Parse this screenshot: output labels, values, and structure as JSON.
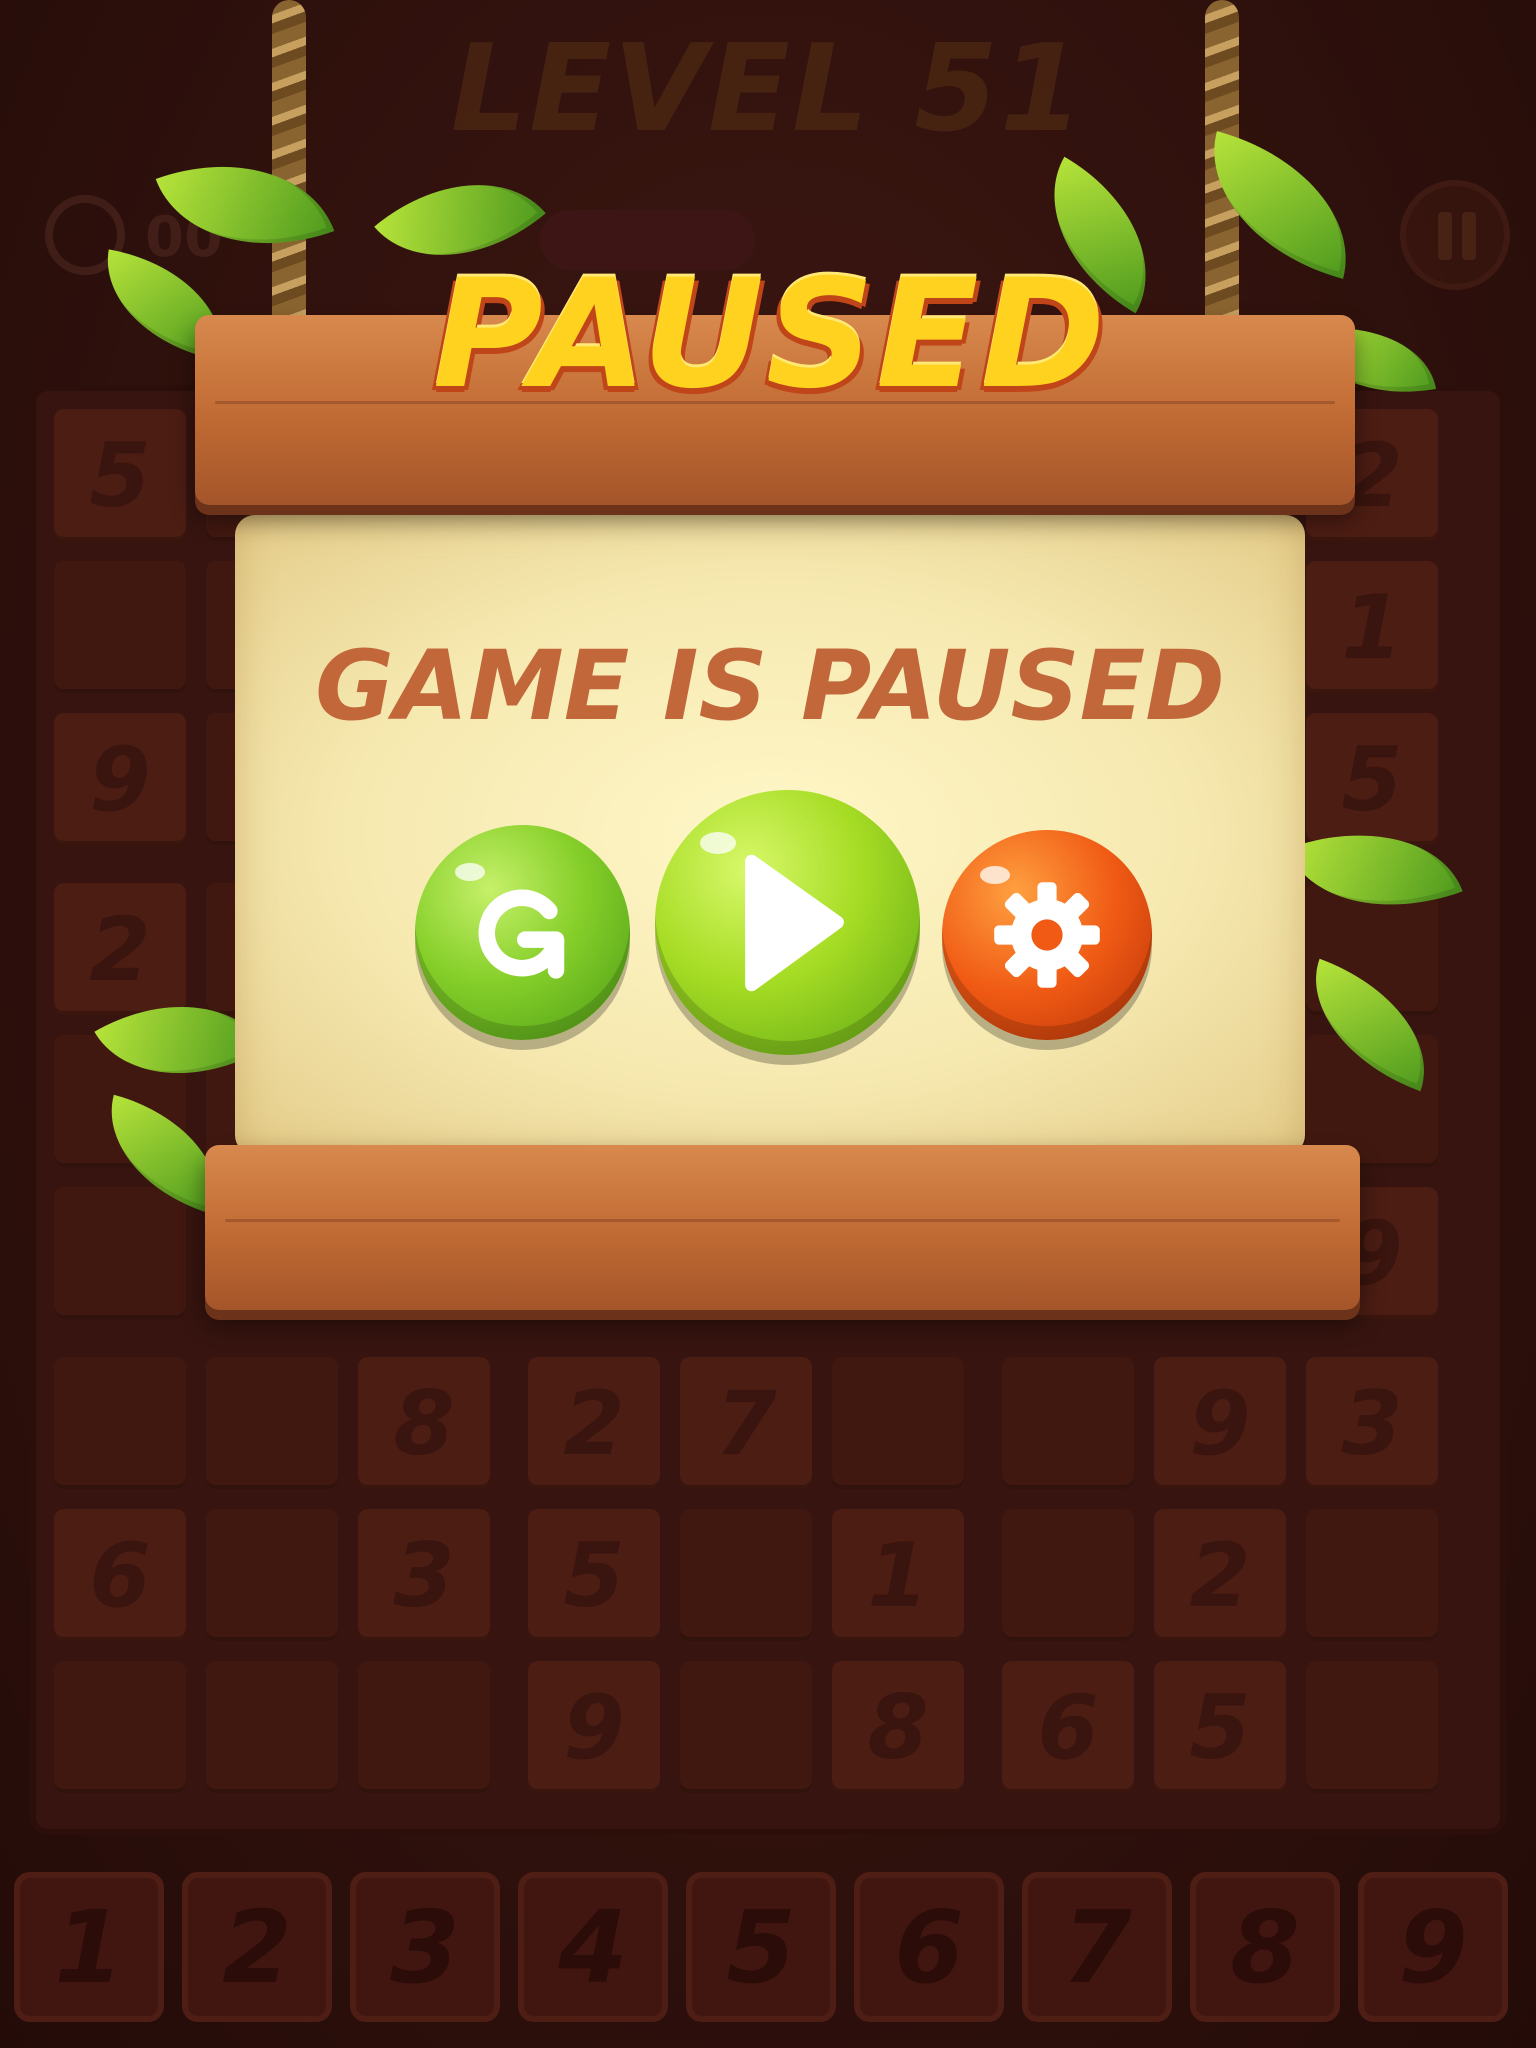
{
  "background_game": {
    "level_title": "LEVEL 51",
    "timer_text": "00",
    "board_cells": [
      {
        "r": 0,
        "c": 0,
        "v": "5"
      },
      {
        "r": 0,
        "c": 8,
        "v": "2"
      },
      {
        "r": 1,
        "c": 8,
        "v": "1"
      },
      {
        "r": 2,
        "c": 0,
        "v": "9"
      },
      {
        "r": 2,
        "c": 8,
        "v": "5"
      },
      {
        "r": 3,
        "c": 0,
        "v": "2"
      },
      {
        "r": 5,
        "c": 8,
        "v": "9"
      },
      {
        "r": 6,
        "c": 2,
        "v": "8"
      },
      {
        "r": 6,
        "c": 3,
        "v": "2"
      },
      {
        "r": 6,
        "c": 4,
        "v": "7"
      },
      {
        "r": 6,
        "c": 7,
        "v": "9"
      },
      {
        "r": 6,
        "c": 8,
        "v": "3"
      },
      {
        "r": 7,
        "c": 0,
        "v": "6"
      },
      {
        "r": 7,
        "c": 2,
        "v": "3"
      },
      {
        "r": 7,
        "c": 3,
        "v": "5"
      },
      {
        "r": 7,
        "c": 5,
        "v": "1"
      },
      {
        "r": 7,
        "c": 7,
        "v": "2"
      },
      {
        "r": 8,
        "c": 3,
        "v": "9"
      },
      {
        "r": 8,
        "c": 5,
        "v": "8"
      },
      {
        "r": 8,
        "c": 6,
        "v": "6"
      },
      {
        "r": 8,
        "c": 7,
        "v": "5"
      }
    ],
    "number_pad": [
      "1",
      "2",
      "3",
      "4",
      "5",
      "6",
      "7",
      "8",
      "9"
    ]
  },
  "popup": {
    "title": "PAUSED",
    "message": "GAME IS PAUSED",
    "buttons": [
      {
        "name": "restart-button",
        "icon": "restart-icon",
        "color": "#86cf2a"
      },
      {
        "name": "play-button",
        "icon": "play-icon",
        "color": "#a6dc24"
      },
      {
        "name": "settings-button",
        "icon": "gear-icon",
        "color": "#f05a14"
      }
    ]
  },
  "colors": {
    "title_fill": "#ffd21f",
    "title_outline": "#c0461a",
    "message": "#c2673a",
    "wood": "#c06a33",
    "parchment": "#f6e9b0"
  }
}
